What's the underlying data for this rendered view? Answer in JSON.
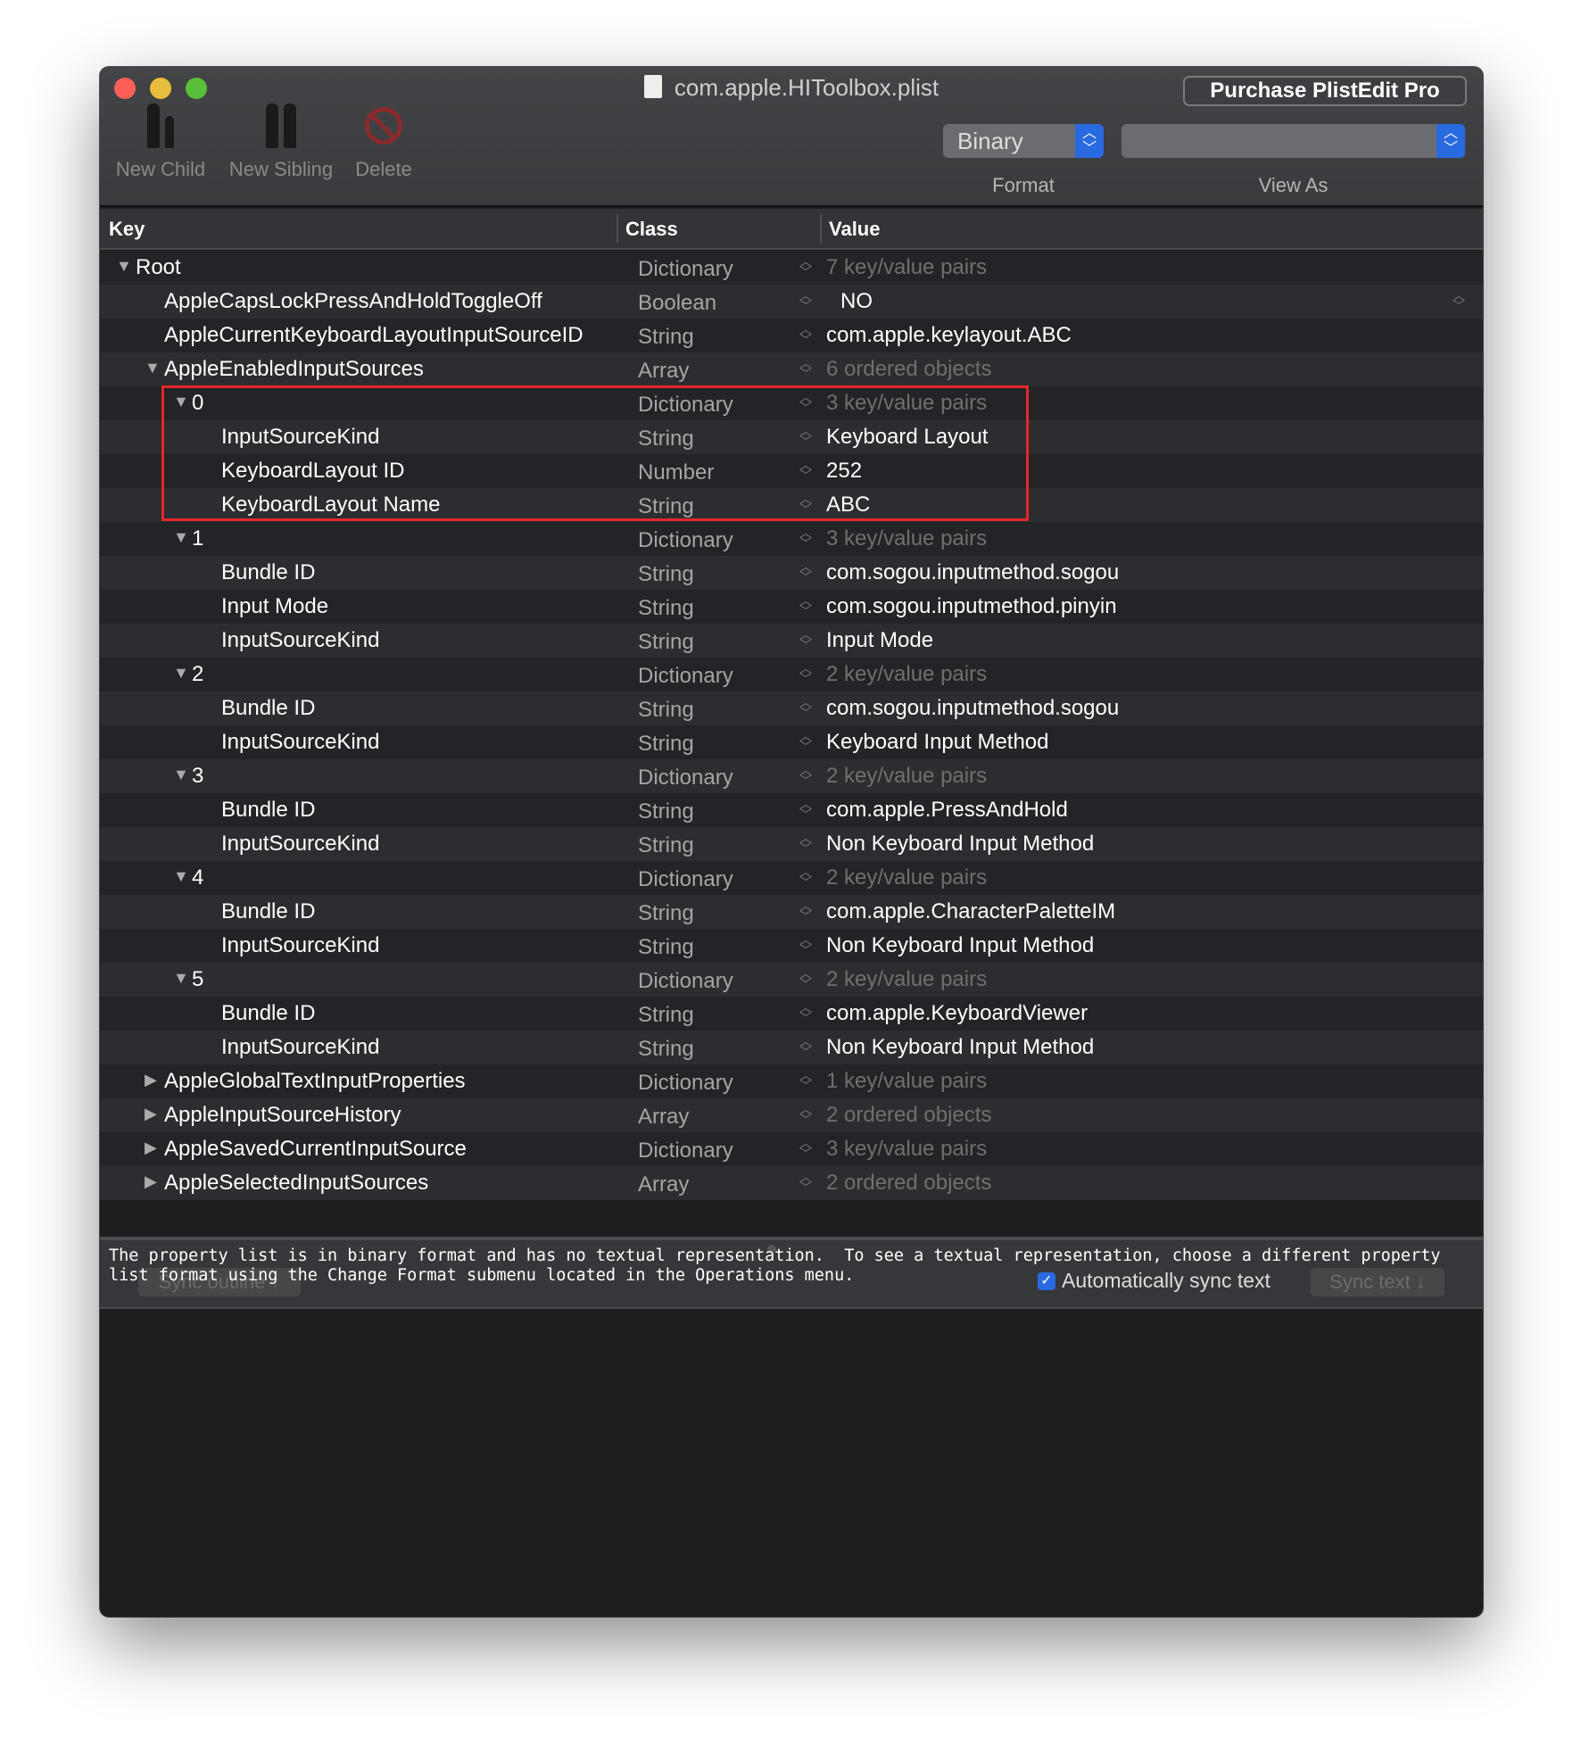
{
  "window": {
    "title": "com.apple.HIToolbox.plist",
    "purchase_label": "Purchase PlistEdit Pro"
  },
  "toolbar": {
    "new_child": "New Child",
    "new_sibling": "New Sibling",
    "delete": "Delete",
    "format_value": "Binary",
    "format_label": "Format",
    "view_as_value": "",
    "view_as_label": "View As"
  },
  "columns": {
    "key": "Key",
    "class": "Class",
    "value": "Value"
  },
  "rows": [
    {
      "level": 0,
      "disclosure": "open",
      "key": "Root",
      "class": "Dictionary",
      "value": "7 key/value pairs",
      "dim": true
    },
    {
      "level": 1,
      "disclosure": "none",
      "key": "AppleCapsLockPressAndHoldToggleOff",
      "class": "Boolean",
      "value": "NO",
      "dim": false,
      "popup": true
    },
    {
      "level": 1,
      "disclosure": "none",
      "key": "AppleCurrentKeyboardLayoutInputSourceID",
      "class": "String",
      "value": "com.apple.keylayout.ABC",
      "dim": false
    },
    {
      "level": 1,
      "disclosure": "open",
      "key": "AppleEnabledInputSources",
      "class": "Array",
      "value": "6 ordered objects",
      "dim": true
    },
    {
      "level": 2,
      "disclosure": "open",
      "key": "0",
      "class": "Dictionary",
      "value": "3 key/value pairs",
      "dim": true
    },
    {
      "level": 3,
      "disclosure": "none",
      "key": "InputSourceKind",
      "class": "String",
      "value": "Keyboard Layout",
      "dim": false
    },
    {
      "level": 3,
      "disclosure": "none",
      "key": "KeyboardLayout ID",
      "class": "Number",
      "value": "252",
      "dim": false
    },
    {
      "level": 3,
      "disclosure": "none",
      "key": "KeyboardLayout Name",
      "class": "String",
      "value": "ABC",
      "dim": false
    },
    {
      "level": 2,
      "disclosure": "open",
      "key": "1",
      "class": "Dictionary",
      "value": "3 key/value pairs",
      "dim": true
    },
    {
      "level": 3,
      "disclosure": "none",
      "key": "Bundle ID",
      "class": "String",
      "value": "com.sogou.inputmethod.sogou",
      "dim": false
    },
    {
      "level": 3,
      "disclosure": "none",
      "key": "Input Mode",
      "class": "String",
      "value": "com.sogou.inputmethod.pinyin",
      "dim": false
    },
    {
      "level": 3,
      "disclosure": "none",
      "key": "InputSourceKind",
      "class": "String",
      "value": "Input Mode",
      "dim": false
    },
    {
      "level": 2,
      "disclosure": "open",
      "key": "2",
      "class": "Dictionary",
      "value": "2 key/value pairs",
      "dim": true
    },
    {
      "level": 3,
      "disclosure": "none",
      "key": "Bundle ID",
      "class": "String",
      "value": "com.sogou.inputmethod.sogou",
      "dim": false
    },
    {
      "level": 3,
      "disclosure": "none",
      "key": "InputSourceKind",
      "class": "String",
      "value": "Keyboard Input Method",
      "dim": false
    },
    {
      "level": 2,
      "disclosure": "open",
      "key": "3",
      "class": "Dictionary",
      "value": "2 key/value pairs",
      "dim": true
    },
    {
      "level": 3,
      "disclosure": "none",
      "key": "Bundle ID",
      "class": "String",
      "value": "com.apple.PressAndHold",
      "dim": false
    },
    {
      "level": 3,
      "disclosure": "none",
      "key": "InputSourceKind",
      "class": "String",
      "value": "Non Keyboard Input Method",
      "dim": false
    },
    {
      "level": 2,
      "disclosure": "open",
      "key": "4",
      "class": "Dictionary",
      "value": "2 key/value pairs",
      "dim": true
    },
    {
      "level": 3,
      "disclosure": "none",
      "key": "Bundle ID",
      "class": "String",
      "value": "com.apple.CharacterPaletteIM",
      "dim": false
    },
    {
      "level": 3,
      "disclosure": "none",
      "key": "InputSourceKind",
      "class": "String",
      "value": "Non Keyboard Input Method",
      "dim": false
    },
    {
      "level": 2,
      "disclosure": "open",
      "key": "5",
      "class": "Dictionary",
      "value": "2 key/value pairs",
      "dim": true
    },
    {
      "level": 3,
      "disclosure": "none",
      "key": "Bundle ID",
      "class": "String",
      "value": "com.apple.KeyboardViewer",
      "dim": false
    },
    {
      "level": 3,
      "disclosure": "none",
      "key": "InputSourceKind",
      "class": "String",
      "value": "Non Keyboard Input Method",
      "dim": false
    },
    {
      "level": 1,
      "disclosure": "closed",
      "key": "AppleGlobalTextInputProperties",
      "class": "Dictionary",
      "value": "1 key/value pairs",
      "dim": true
    },
    {
      "level": 1,
      "disclosure": "closed",
      "key": "AppleInputSourceHistory",
      "class": "Array",
      "value": "2 ordered objects",
      "dim": true
    },
    {
      "level": 1,
      "disclosure": "closed",
      "key": "AppleSavedCurrentInputSource",
      "class": "Dictionary",
      "value": "3 key/value pairs",
      "dim": true
    },
    {
      "level": 1,
      "disclosure": "closed",
      "key": "AppleSelectedInputSources",
      "class": "Array",
      "value": "2 ordered objects",
      "dim": true
    }
  ],
  "bottom": {
    "sync_outline": "Sync outline ↑",
    "auto_sync_label": "Automatically sync text",
    "auto_sync_checked": true,
    "sync_text": "Sync text ↓"
  },
  "text_view": "The property list is in binary format and has no textual representation.  To see a textual representation, choose a different property list format using the Change Format submenu located in the Operations menu.",
  "colors": {
    "accent": "#2a6ae0",
    "highlight_box": "#e3262a",
    "close": "#fc5f57",
    "minimize": "#e6bd3c",
    "zoom": "#57c038"
  }
}
